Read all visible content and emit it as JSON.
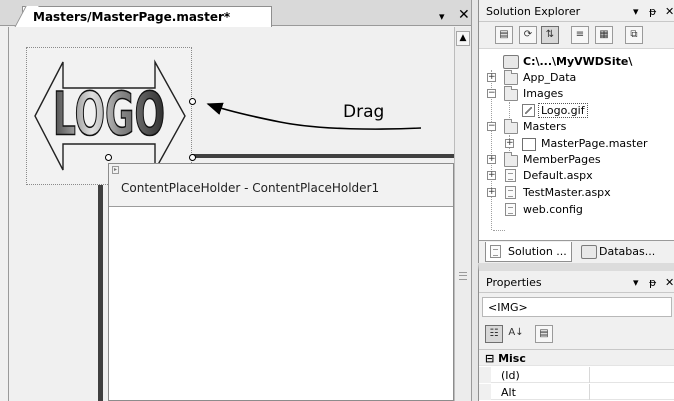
{
  "document": {
    "tab_title": "Masters/MasterPage.master*",
    "dropdown_glyph": "▾",
    "close_glyph": "✕",
    "scroll_up_glyph": "▲"
  },
  "designer": {
    "content_placeholder_label": "ContentPlaceHolder - ContentPlaceHolder1",
    "drag_label": "Drag",
    "logo_text": "LOGO"
  },
  "solution_explorer": {
    "title": "Solution Explorer",
    "dropdown_glyph": "▾",
    "pin_glyph": "ᵽ",
    "close_glyph": "✕",
    "toolbar_icons": [
      "properties-icon",
      "refresh-icon",
      "nest-related-files-icon",
      "view-code-icon",
      "view-designer-icon",
      "copy-website-icon"
    ],
    "tree": {
      "root": "C:\\...\\MyVWDSite\\",
      "items": [
        {
          "label": "App_Data",
          "expander": "+"
        },
        {
          "label": "Images",
          "expander": "−"
        },
        {
          "label": "Logo.gif",
          "expander": ""
        },
        {
          "label": "Masters",
          "expander": "−"
        },
        {
          "label": "MasterPage.master",
          "expander": "+"
        },
        {
          "label": "MemberPages",
          "expander": "+"
        },
        {
          "label": "Default.aspx",
          "expander": "+"
        },
        {
          "label": "TestMaster.aspx",
          "expander": "+"
        },
        {
          "label": "web.config",
          "expander": ""
        }
      ]
    },
    "bottom_tabs": [
      "Solution ...",
      "Databas..."
    ]
  },
  "properties": {
    "title": "Properties",
    "dropdown_glyph": "▾",
    "pin_glyph": "ᵽ",
    "close_glyph": "✕",
    "selected_object": "<IMG>",
    "toolbar": {
      "categorized_glyph": "☷",
      "alphabetical_glyph": "A↓",
      "pages_glyph": "▤"
    },
    "category": {
      "label": "Misc",
      "expander": "⊟"
    },
    "rows": [
      "(Id)",
      "Alt"
    ]
  }
}
